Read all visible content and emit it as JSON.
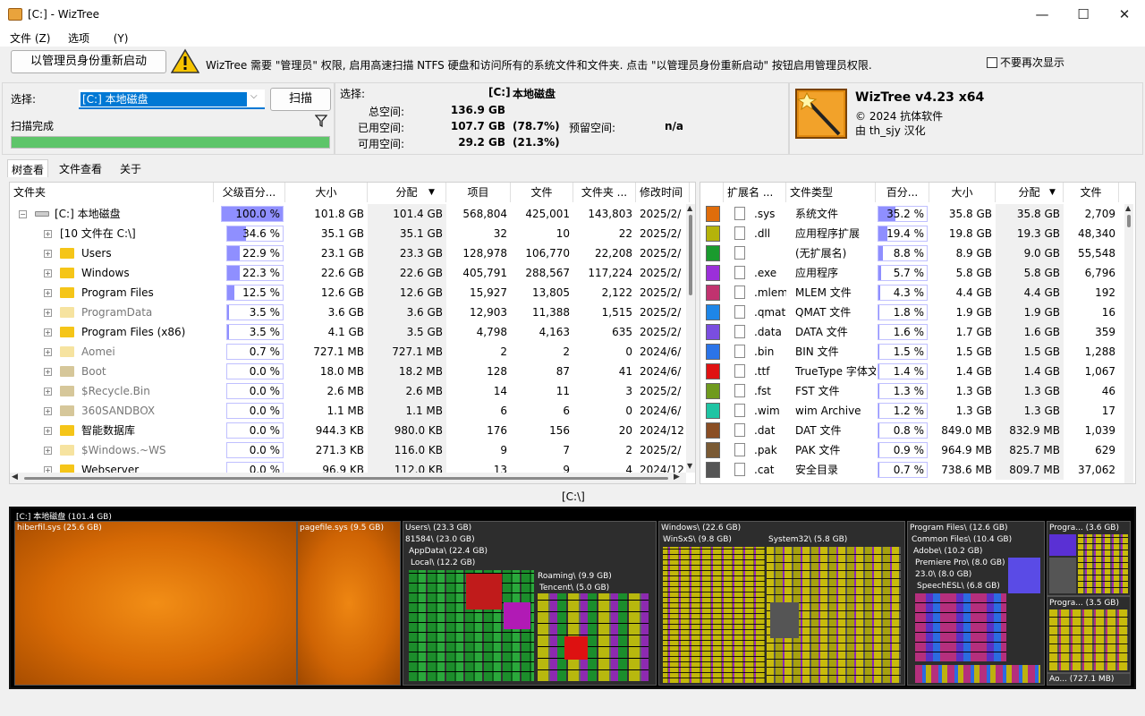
{
  "window": {
    "title": "[C:]  - WizTree",
    "min": "—",
    "max": "☐",
    "close": "✕"
  },
  "menu": [
    {
      "label": "文件",
      "accel": "(Z)"
    },
    {
      "label": "选项",
      "accel": "(Y)"
    }
  ],
  "banner": {
    "restart_label": "以管理员身份重新启动",
    "message": "WizTree 需要 \"管理员\" 权限, 启用高速扫描 NTFS 硬盘和访问所有的系统文件和文件夹. 点击 \"以管理员身份重新启动\" 按钮启用管理员权限.",
    "dont_show_label": "不要再次显示"
  },
  "scan": {
    "select_label": "选择:",
    "drive_value": "[C:] 本地磁盘",
    "scan_button": "扫描",
    "status": "扫描完成",
    "progress_fraction": 1.0
  },
  "info": {
    "select_label": "选择:",
    "drive": "[C:]",
    "drive_name": "本地磁盘",
    "total_label": "总空间:",
    "total_value": "136.9 GB",
    "used_label": "已用空间:",
    "used_value": "107.7 GB",
    "used_pct": "(78.7%)",
    "reserved_label": "预留空间:",
    "reserved_value": "n/a",
    "free_label": "可用空间:",
    "free_value": "29.2 GB",
    "free_pct": "(21.3%)"
  },
  "about": {
    "product": "WizTree v4.23 x64",
    "copyright": "© 2024 抗体软件",
    "translator": "由 th_sjy 汉化"
  },
  "tabs": [
    "树查看",
    "文件查看",
    "关于"
  ],
  "tree": {
    "headers": [
      "文件夹",
      "父级百分...",
      "大小",
      "分配",
      "项目",
      "文件",
      "文件夹 ...",
      "修改时间"
    ],
    "rows": [
      {
        "name": "[C:] 本地磁盘",
        "pct": "100.0 %",
        "pctv": 1.0,
        "size": "101.8 GB",
        "alloc": "101.4 GB",
        "items": "568,804",
        "files": "425,001",
        "folders": "143,803",
        "mod": "2025/2/",
        "depth": 0,
        "icon": "drive",
        "expander": "−"
      },
      {
        "name": "[10 文件在      C:\\]",
        "pct": "34.6 %",
        "pctv": 0.346,
        "size": "35.1 GB",
        "alloc": "35.1 GB",
        "items": "32",
        "files": "10",
        "folders": "22",
        "mod": "2025/2/",
        "depth": 1,
        "icon": "none",
        "expander": "+"
      },
      {
        "name": "Users",
        "pct": "22.9 %",
        "pctv": 0.229,
        "size": "23.1 GB",
        "alloc": "23.3 GB",
        "items": "128,978",
        "files": "106,770",
        "folders": "22,208",
        "mod": "2025/2/",
        "depth": 1,
        "icon": "folder",
        "expander": "+"
      },
      {
        "name": "Windows",
        "pct": "22.3 %",
        "pctv": 0.223,
        "size": "22.6 GB",
        "alloc": "22.6 GB",
        "items": "405,791",
        "files": "288,567",
        "folders": "117,224",
        "mod": "2025/2/",
        "depth": 1,
        "icon": "folder",
        "expander": "+"
      },
      {
        "name": "Program Files",
        "pct": "12.5 %",
        "pctv": 0.125,
        "size": "12.6 GB",
        "alloc": "12.6 GB",
        "items": "15,927",
        "files": "13,805",
        "folders": "2,122",
        "mod": "2025/2/",
        "depth": 1,
        "icon": "folder",
        "expander": "+"
      },
      {
        "name": "ProgramData",
        "pct": "3.5 %",
        "pctv": 0.035,
        "size": "3.6 GB",
        "alloc": "3.6 GB",
        "items": "12,903",
        "files": "11,388",
        "folders": "1,515",
        "mod": "2025/2/",
        "depth": 1,
        "icon": "dim",
        "expander": "+"
      },
      {
        "name": "Program Files (x86)",
        "pct": "3.5 %",
        "pctv": 0.035,
        "size": "4.1 GB",
        "alloc": "3.5 GB",
        "items": "4,798",
        "files": "4,163",
        "folders": "635",
        "mod": "2025/2/",
        "depth": 1,
        "icon": "folder",
        "expander": "+"
      },
      {
        "name": "Aomei",
        "pct": "0.7 %",
        "pctv": 0.007,
        "size": "727.1 MB",
        "alloc": "727.1 MB",
        "items": "2",
        "files": "2",
        "folders": "0",
        "mod": "2024/6/",
        "depth": 1,
        "icon": "dim",
        "expander": "+"
      },
      {
        "name": "Boot",
        "pct": "0.0 %",
        "pctv": 0.0,
        "size": "18.0 MB",
        "alloc": "18.2 MB",
        "items": "128",
        "files": "87",
        "folders": "41",
        "mod": "2024/6/",
        "depth": 1,
        "icon": "sys",
        "expander": "+"
      },
      {
        "name": "$Recycle.Bin",
        "pct": "0.0 %",
        "pctv": 0.0,
        "size": "2.6 MB",
        "alloc": "2.6 MB",
        "items": "14",
        "files": "11",
        "folders": "3",
        "mod": "2025/2/",
        "depth": 1,
        "icon": "sys",
        "expander": "+"
      },
      {
        "name": "360SANDBOX",
        "pct": "0.0 %",
        "pctv": 0.0,
        "size": "1.1 MB",
        "alloc": "1.1 MB",
        "items": "6",
        "files": "6",
        "folders": "0",
        "mod": "2024/6/",
        "depth": 1,
        "icon": "sys",
        "expander": "+"
      },
      {
        "name": "智能数据库",
        "pct": "0.0 %",
        "pctv": 0.0,
        "size": "944.3 KB",
        "alloc": "980.0 KB",
        "items": "176",
        "files": "156",
        "folders": "20",
        "mod": "2024/12",
        "depth": 1,
        "icon": "folder",
        "expander": "+"
      },
      {
        "name": "$Windows.~WS",
        "pct": "0.0 %",
        "pctv": 0.0,
        "size": "271.3 KB",
        "alloc": "116.0 KB",
        "items": "9",
        "files": "7",
        "folders": "2",
        "mod": "2025/2/",
        "depth": 1,
        "icon": "dim",
        "expander": "+"
      },
      {
        "name": "Webserver",
        "pct": "0.0 %",
        "pctv": 0.0,
        "size": "96.9 KB",
        "alloc": "112.0 KB",
        "items": "13",
        "files": "9",
        "folders": "4",
        "mod": "2024/12",
        "depth": 1,
        "icon": "folder",
        "expander": "+"
      }
    ]
  },
  "ext": {
    "headers": [
      "扩展名 ...",
      "文件类型",
      "百分...",
      "大小",
      "分配",
      "文件"
    ],
    "rows": [
      {
        "ext": ".sys",
        "type": "系统文件",
        "pct": "35.2 %",
        "pctv": 0.352,
        "size": "35.8 GB",
        "alloc": "35.8 GB",
        "files": "2,709",
        "color": "#e06d0b"
      },
      {
        "ext": ".dll",
        "type": "应用程序扩展",
        "pct": "19.4 %",
        "pctv": 0.194,
        "size": "19.8 GB",
        "alloc": "19.3 GB",
        "files": "48,340",
        "color": "#b5b30a"
      },
      {
        "ext": "",
        "type": "(无扩展名)",
        "pct": "8.8 %",
        "pctv": 0.088,
        "size": "8.9 GB",
        "alloc": "9.0 GB",
        "files": "55,548",
        "color": "#1a9b2e"
      },
      {
        "ext": ".exe",
        "type": "应用程序",
        "pct": "5.7 %",
        "pctv": 0.057,
        "size": "5.8 GB",
        "alloc": "5.8 GB",
        "files": "6,796",
        "color": "#9b2fd9"
      },
      {
        "ext": ".mlem",
        "type": "MLEM 文件",
        "pct": "4.3 %",
        "pctv": 0.043,
        "size": "4.4 GB",
        "alloc": "4.4 GB",
        "files": "192",
        "color": "#c1336f"
      },
      {
        "ext": ".qmat",
        "type": "QMAT 文件",
        "pct": "1.8 %",
        "pctv": 0.018,
        "size": "1.9 GB",
        "alloc": "1.9 GB",
        "files": "16",
        "color": "#1e86e8"
      },
      {
        "ext": ".data",
        "type": "DATA 文件",
        "pct": "1.6 %",
        "pctv": 0.016,
        "size": "1.7 GB",
        "alloc": "1.6 GB",
        "files": "359",
        "color": "#7a4ee0"
      },
      {
        "ext": ".bin",
        "type": "BIN 文件",
        "pct": "1.5 %",
        "pctv": 0.015,
        "size": "1.5 GB",
        "alloc": "1.5 GB",
        "files": "1,288",
        "color": "#2b74e8"
      },
      {
        "ext": ".ttf",
        "type": "TrueType 字体文",
        "pct": "1.4 %",
        "pctv": 0.014,
        "size": "1.4 GB",
        "alloc": "1.4 GB",
        "files": "1,067",
        "color": "#e01212"
      },
      {
        "ext": ".fst",
        "type": "FST 文件",
        "pct": "1.3 %",
        "pctv": 0.013,
        "size": "1.3 GB",
        "alloc": "1.3 GB",
        "files": "46",
        "color": "#6f9a1e"
      },
      {
        "ext": ".wim",
        "type": "wim Archive",
        "pct": "1.2 %",
        "pctv": 0.012,
        "size": "1.3 GB",
        "alloc": "1.3 GB",
        "files": "17",
        "color": "#1fc4a3"
      },
      {
        "ext": ".dat",
        "type": "DAT 文件",
        "pct": "0.8 %",
        "pctv": 0.008,
        "size": "849.0 MB",
        "alloc": "832.9 MB",
        "files": "1,039",
        "color": "#8a4e24"
      },
      {
        "ext": ".pak",
        "type": "PAK 文件",
        "pct": "0.9 %",
        "pctv": 0.009,
        "size": "964.9 MB",
        "alloc": "825.7 MB",
        "files": "629",
        "color": "#7a5a34"
      },
      {
        "ext": ".cat",
        "type": "安全目录",
        "pct": "0.7 %",
        "pctv": 0.007,
        "size": "738.6 MB",
        "alloc": "809.7 MB",
        "files": "37,062",
        "color": "#555555"
      }
    ]
  },
  "treemap": {
    "path_label": "[C:\\]",
    "root": "[C:] 本地磁盘 (101.4 GB)",
    "labels": {
      "hiberfil": "hiberfil.sys (25.6 GB)",
      "pagefile": "pagefile.sys (9.5 GB)",
      "users": "Users\\ (23.3 GB)",
      "u81584": "81584\\ (23.0 GB)",
      "appdata": "AppData\\ (22.4 GB)",
      "local": "Local\\ (12.2 GB)",
      "roaming": "Roaming\\ (9.9 GB)",
      "tencent": "Tencent\\ (5.0 GB)",
      "windows": "Windows\\ (22.6 GB)",
      "winsxs": "WinSxS\\ (9.8 GB)",
      "system32": "System32\\ (5.8 GB)",
      "progfiles": "Program Files\\ (12.6 GB)",
      "common": "Common Files\\ (10.4 GB)",
      "adobe": "Adobe\\ (10.2 GB)",
      "premiere": "Premiere Pro\\ (8.0 GB)",
      "v23": "23.0\\ (8.0 GB)",
      "speechesl": "SpeechESL\\ (6.8 GB)",
      "progra1": "Progra... (3.6 GB)",
      "progra2": "Progra... (3.5 GB)",
      "ao": "Ao... (727.1 MB)"
    }
  }
}
